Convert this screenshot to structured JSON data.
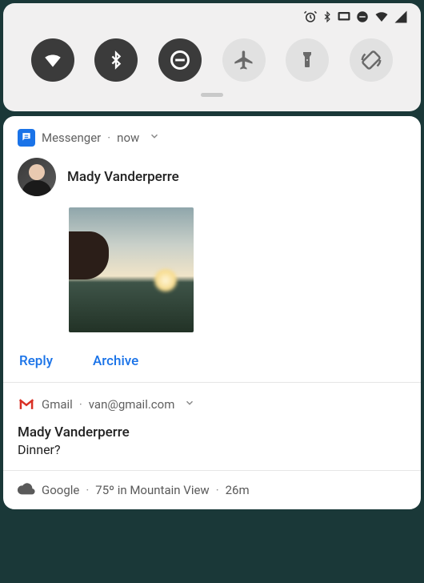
{
  "notifications": {
    "messenger": {
      "app": "Messenger",
      "time": "now",
      "sender": "Mady Vanderperre",
      "actions": {
        "reply": "Reply",
        "archive": "Archive"
      }
    },
    "gmail": {
      "app": "Gmail",
      "account": "van@gmail.com",
      "title": "Mady Vanderperre",
      "body": "Dinner?"
    },
    "google": {
      "app": "Google",
      "weather": "75º in Mountain View",
      "time": "26m"
    }
  }
}
